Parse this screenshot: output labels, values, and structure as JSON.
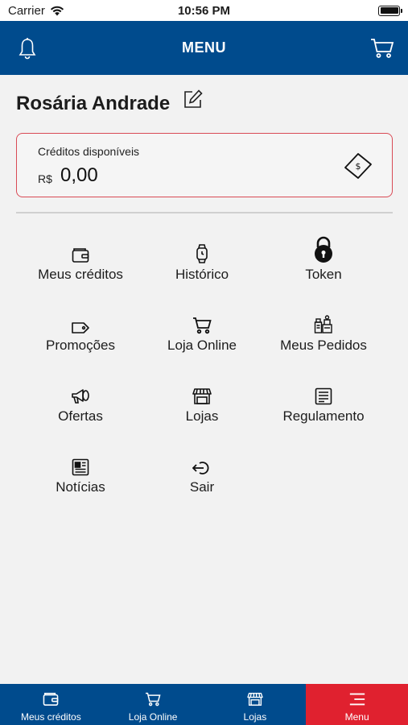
{
  "status": {
    "carrier": "Carrier",
    "time": "10:56 PM"
  },
  "header": {
    "title": "MENU"
  },
  "user": {
    "name": "Rosária Andrade"
  },
  "credits": {
    "label": "Créditos disponíveis",
    "currency": "R$",
    "value": "0,00"
  },
  "menu": [
    {
      "label": "Meus créditos",
      "icon": "wallet-icon"
    },
    {
      "label": "Histórico",
      "icon": "watch-icon"
    },
    {
      "label": "Token",
      "icon": "padlock-icon"
    },
    {
      "label": "Promoções",
      "icon": "tag-icon"
    },
    {
      "label": "Loja Online",
      "icon": "cart-icon"
    },
    {
      "label": "Meus Pedidos",
      "icon": "products-icon"
    },
    {
      "label": "Ofertas",
      "icon": "megaphone-icon"
    },
    {
      "label": "Lojas",
      "icon": "store-icon"
    },
    {
      "label": "Regulamento",
      "icon": "document-icon"
    },
    {
      "label": "Notícias",
      "icon": "newspaper-icon"
    },
    {
      "label": "Sair",
      "icon": "logout-icon"
    }
  ],
  "tabs": [
    {
      "label": "Meus créditos",
      "icon": "wallet-icon"
    },
    {
      "label": "Loja Online",
      "icon": "cart-icon"
    },
    {
      "label": "Lojas",
      "icon": "store-icon"
    },
    {
      "label": "Menu",
      "icon": "menu-icon",
      "active": true
    }
  ],
  "colors": {
    "brand_blue": "#004b8d",
    "accent_red": "#e0212f",
    "card_border": "#d94a55"
  }
}
